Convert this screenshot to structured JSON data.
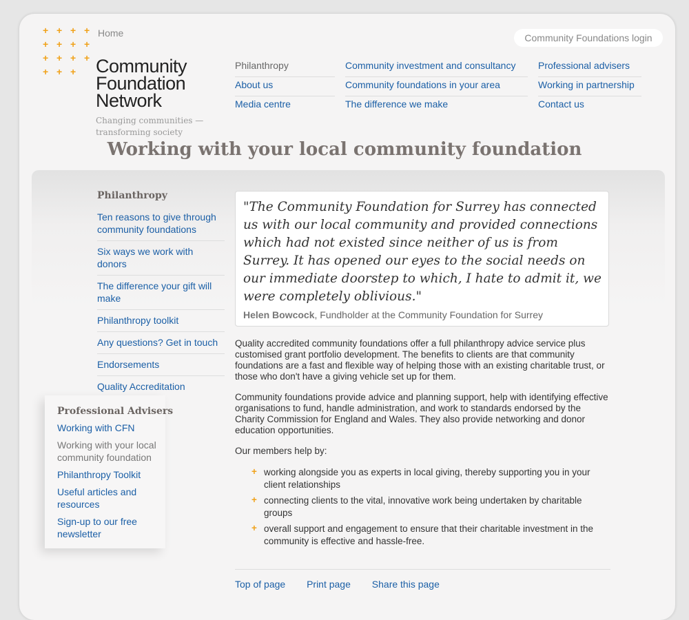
{
  "header": {
    "home": "Home",
    "logo_name": [
      "Community",
      "Foundation",
      "Network"
    ],
    "logo_tagline": [
      "Changing communities —",
      "transforming society"
    ],
    "login": "Community Foundations login"
  },
  "topnav": {
    "col1": [
      "Philanthropy",
      "About us",
      "Media centre"
    ],
    "col2": [
      "Community investment and consultancy",
      "Community foundations in your area",
      "The difference we make"
    ],
    "col3": [
      "Professional advisers",
      "Working in partnership",
      "Contact us"
    ]
  },
  "page_title": "Working with your local community foundation",
  "sidebar": {
    "heading": "Philanthropy",
    "items": [
      "Ten reasons to give through community foundations",
      "Six ways we work with donors",
      "The difference your gift will make",
      "Philanthropy toolkit",
      "Any questions? Get in touch",
      "Endorsements",
      "Quality Accreditation"
    ]
  },
  "professional": {
    "heading": "Professional Advisers",
    "items": [
      "Working with CFN",
      "Working with your local community foundation",
      "Philanthropy Toolkit",
      "Useful articles and resources",
      "Sign-up to our free newsletter"
    ]
  },
  "quote": {
    "text": "\"The Community Foundation for Surrey has connected us with our local community and provided connections which had not existed since neither of us is from Surrey. It has opened our eyes to the social needs on our immediate doorstep to which, I hate to admit it, we were completely oblivious.\"",
    "author": "Helen Bowcock",
    "role": ", Fundholder at the Community Foundation for Surrey"
  },
  "body": {
    "p1": "Quality accredited community foundations offer a full philanthropy advice service plus customised grant portfolio development. The benefits to clients are that community foundations are a fast and flexible way of helping those with an existing charitable trust, or those who don't have a giving vehicle set up for them.",
    "p2": "Community foundations provide advice and planning support, help with identifying effective organisations to fund, handle administration, and work to standards endorsed by the Charity Commission for England and Wales. They also provide networking and donor education opportunities.",
    "p3": "Our members help by:",
    "bullets": [
      "working alongside you as experts in local giving, thereby supporting you in your client relationships",
      "connecting clients to the vital, innovative work being undertaken by charitable groups",
      "overall support and engagement to ensure that their charitable investment in the community is effective and hassle-free."
    ]
  },
  "footer": {
    "top": "Top of page",
    "print": "Print page",
    "share": "Share this page"
  },
  "colors": {
    "accent": "#f0a21a",
    "link": "#1b5fa6"
  }
}
